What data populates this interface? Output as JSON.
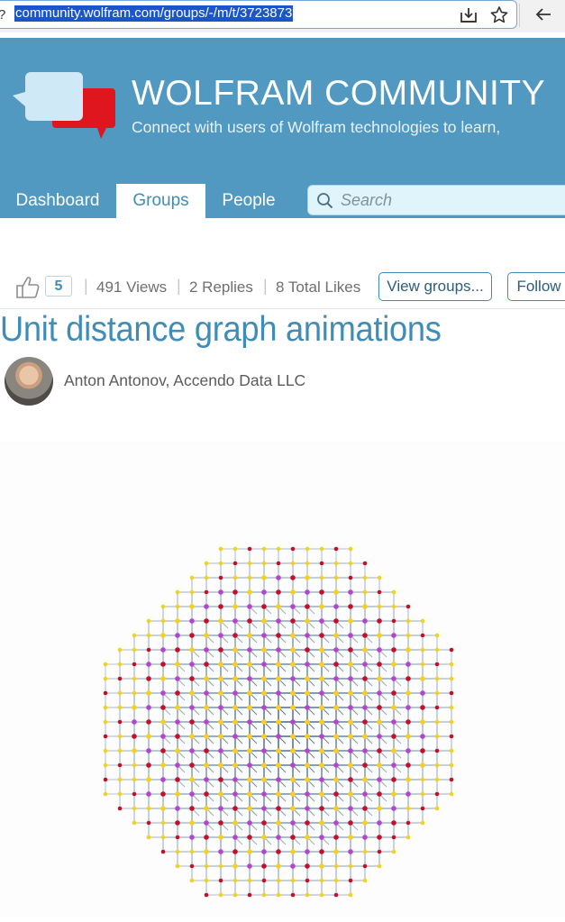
{
  "browser": {
    "url": "community.wolfram.com/groups/-/m/t/3723873",
    "left_edge_glyph": "?",
    "icons": [
      "download-icon",
      "star-icon",
      "back-arrow-icon"
    ]
  },
  "site": {
    "title": "WOLFRAM COMMUNITY",
    "tagline": "Connect with users of Wolfram technologies to learn,",
    "logo": "speech-bubbles-logo",
    "colors": {
      "header": "#5199c1",
      "accent": "#3f8db7",
      "logo_red": "#e0161e",
      "logo_bubble": "#cfeaf6"
    }
  },
  "nav": {
    "items": [
      {
        "label": "Dashboard",
        "active": false
      },
      {
        "label": "Groups",
        "active": true
      },
      {
        "label": "People",
        "active": false
      }
    ],
    "search_placeholder": "Search"
  },
  "stats": {
    "likes": "5",
    "views": "491 Views",
    "replies": "2 Replies",
    "total_likes": "8 Total Likes",
    "view_groups_label": "View groups...",
    "follow_label": "Follow"
  },
  "post": {
    "title": "Unit distance graph animations",
    "author": "Anton Antonov, Accendo Data LLC"
  },
  "figure": {
    "kind": "unit distance graph",
    "node_colors": [
      "#c0102a",
      "#f2d21b",
      "#b445c9"
    ],
    "edge_color": "#2f4f78"
  }
}
